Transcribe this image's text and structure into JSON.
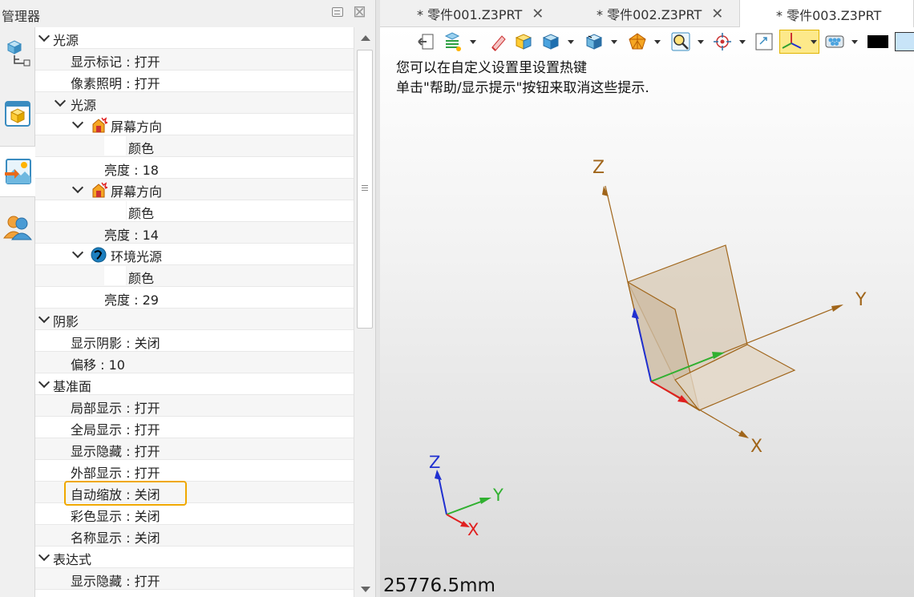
{
  "panel": {
    "title": "管理器"
  },
  "tree": {
    "rows": [
      {
        "label": "光源",
        "indent": 0,
        "expand": true
      },
      {
        "label": "显示标记 : 打开",
        "indent": 1
      },
      {
        "label": "像素照明 : 打开",
        "indent": 1
      },
      {
        "label": "光源",
        "indent": 1,
        "expand": true
      },
      {
        "label": "屏幕方向",
        "indent": 2,
        "expand": true,
        "icon": "spotlight-icon"
      },
      {
        "label": "颜色",
        "indent": 3,
        "swatch": true
      },
      {
        "label": "亮度 : 18",
        "indent": 3
      },
      {
        "label": "屏幕方向",
        "indent": 2,
        "expand": true,
        "icon": "spotlight-icon"
      },
      {
        "label": "颜色",
        "indent": 3,
        "swatch": true
      },
      {
        "label": "亮度 : 14",
        "indent": 3
      },
      {
        "label": "环境光源",
        "indent": 2,
        "expand": true,
        "icon": "ambient-light-icon"
      },
      {
        "label": "颜色",
        "indent": 3,
        "swatch": true
      },
      {
        "label": "亮度 : 29",
        "indent": 3
      },
      {
        "label": "阴影",
        "indent": 0,
        "expand": true
      },
      {
        "label": "显示阴影 : 关闭",
        "indent": 1
      },
      {
        "label": "偏移 : 10",
        "indent": 1
      },
      {
        "label": "基准面",
        "indent": 0,
        "expand": true
      },
      {
        "label": "局部显示 : 打开",
        "indent": 1
      },
      {
        "label": "全局显示 : 打开",
        "indent": 1
      },
      {
        "label": "显示隐藏 : 打开",
        "indent": 1
      },
      {
        "label": "外部显示 : 打开",
        "indent": 1
      },
      {
        "label": "自动缩放 : 关闭",
        "indent": 1
      },
      {
        "label": "彩色显示 : 关闭",
        "indent": 1
      },
      {
        "label": "名称显示 : 关闭",
        "indent": 1
      },
      {
        "label": "表达式",
        "indent": 0,
        "expand": true
      },
      {
        "label": "显示隐藏 : 打开",
        "indent": 1
      }
    ]
  },
  "tabs": [
    {
      "label": "* 零件001.Z3PRT",
      "active": false
    },
    {
      "label": "* 零件002.Z3PRT",
      "active": false
    },
    {
      "label": "* 零件003.Z3PRT",
      "active": true
    }
  ],
  "viewport": {
    "hint_line1": "您可以在自定义设置里设置热键",
    "hint_line2": "单击\"帮助/显示提示\"按钮来取消这些提示.",
    "scale_readout": "25776.5mm",
    "axes": {
      "x": "X",
      "y": "Y",
      "z": "Z"
    }
  },
  "colors": {
    "highlight": "#f0a800",
    "axis_brown": "#a0651a",
    "axis_x": "#e02020",
    "axis_y": "#30b030",
    "axis_z": "#2030d0",
    "solid_fill": "#d8c9b4"
  },
  "toolbar_icons": [
    "exit-icon",
    "history-icon",
    "eraser-icon",
    "shaded-box-icon",
    "solid-box-icon",
    "view-cube-icon",
    "render-ball-icon",
    "zoom-fit-icon",
    "target-icon",
    "window-icon",
    "triad-icon",
    "render-icon",
    "color-swatch-icon",
    "background-swatch-icon"
  ]
}
